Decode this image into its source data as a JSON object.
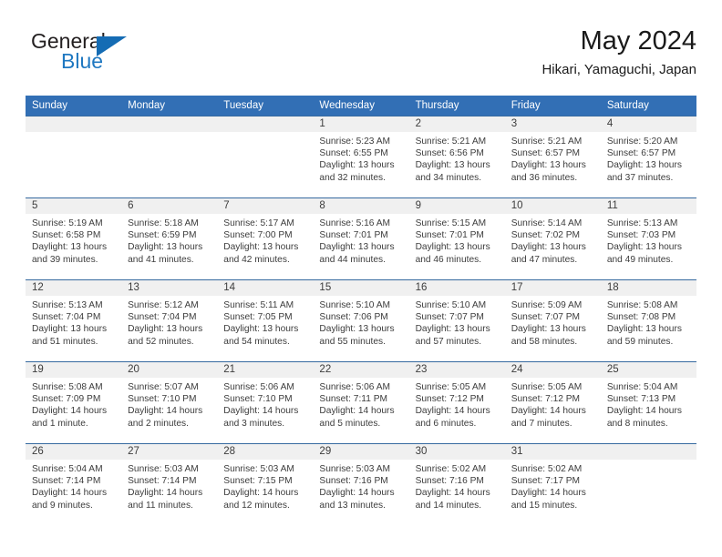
{
  "brand": {
    "word_one": "General",
    "word_two": "Blue",
    "accent_color": "#156cb4",
    "triangle_icon": "brand-triangle-icon"
  },
  "header": {
    "title": "May 2024",
    "subtitle": "Hikari, Yamaguchi, Japan"
  },
  "calendar": {
    "header_bg": "#326fb5",
    "daynum_bg": "#f0f0f0",
    "weekdays": [
      "Sunday",
      "Monday",
      "Tuesday",
      "Wednesday",
      "Thursday",
      "Friday",
      "Saturday"
    ],
    "weeks": [
      [
        {
          "day": "",
          "lines": []
        },
        {
          "day": "",
          "lines": []
        },
        {
          "day": "",
          "lines": []
        },
        {
          "day": "1",
          "lines": [
            "Sunrise: 5:23 AM",
            "Sunset: 6:55 PM",
            "Daylight: 13 hours and 32 minutes."
          ]
        },
        {
          "day": "2",
          "lines": [
            "Sunrise: 5:21 AM",
            "Sunset: 6:56 PM",
            "Daylight: 13 hours and 34 minutes."
          ]
        },
        {
          "day": "3",
          "lines": [
            "Sunrise: 5:21 AM",
            "Sunset: 6:57 PM",
            "Daylight: 13 hours and 36 minutes."
          ]
        },
        {
          "day": "4",
          "lines": [
            "Sunrise: 5:20 AM",
            "Sunset: 6:57 PM",
            "Daylight: 13 hours and 37 minutes."
          ]
        }
      ],
      [
        {
          "day": "5",
          "lines": [
            "Sunrise: 5:19 AM",
            "Sunset: 6:58 PM",
            "Daylight: 13 hours and 39 minutes."
          ]
        },
        {
          "day": "6",
          "lines": [
            "Sunrise: 5:18 AM",
            "Sunset: 6:59 PM",
            "Daylight: 13 hours and 41 minutes."
          ]
        },
        {
          "day": "7",
          "lines": [
            "Sunrise: 5:17 AM",
            "Sunset: 7:00 PM",
            "Daylight: 13 hours and 42 minutes."
          ]
        },
        {
          "day": "8",
          "lines": [
            "Sunrise: 5:16 AM",
            "Sunset: 7:01 PM",
            "Daylight: 13 hours and 44 minutes."
          ]
        },
        {
          "day": "9",
          "lines": [
            "Sunrise: 5:15 AM",
            "Sunset: 7:01 PM",
            "Daylight: 13 hours and 46 minutes."
          ]
        },
        {
          "day": "10",
          "lines": [
            "Sunrise: 5:14 AM",
            "Sunset: 7:02 PM",
            "Daylight: 13 hours and 47 minutes."
          ]
        },
        {
          "day": "11",
          "lines": [
            "Sunrise: 5:13 AM",
            "Sunset: 7:03 PM",
            "Daylight: 13 hours and 49 minutes."
          ]
        }
      ],
      [
        {
          "day": "12",
          "lines": [
            "Sunrise: 5:13 AM",
            "Sunset: 7:04 PM",
            "Daylight: 13 hours and 51 minutes."
          ]
        },
        {
          "day": "13",
          "lines": [
            "Sunrise: 5:12 AM",
            "Sunset: 7:04 PM",
            "Daylight: 13 hours and 52 minutes."
          ]
        },
        {
          "day": "14",
          "lines": [
            "Sunrise: 5:11 AM",
            "Sunset: 7:05 PM",
            "Daylight: 13 hours and 54 minutes."
          ]
        },
        {
          "day": "15",
          "lines": [
            "Sunrise: 5:10 AM",
            "Sunset: 7:06 PM",
            "Daylight: 13 hours and 55 minutes."
          ]
        },
        {
          "day": "16",
          "lines": [
            "Sunrise: 5:10 AM",
            "Sunset: 7:07 PM",
            "Daylight: 13 hours and 57 minutes."
          ]
        },
        {
          "day": "17",
          "lines": [
            "Sunrise: 5:09 AM",
            "Sunset: 7:07 PM",
            "Daylight: 13 hours and 58 minutes."
          ]
        },
        {
          "day": "18",
          "lines": [
            "Sunrise: 5:08 AM",
            "Sunset: 7:08 PM",
            "Daylight: 13 hours and 59 minutes."
          ]
        }
      ],
      [
        {
          "day": "19",
          "lines": [
            "Sunrise: 5:08 AM",
            "Sunset: 7:09 PM",
            "Daylight: 14 hours and 1 minute."
          ]
        },
        {
          "day": "20",
          "lines": [
            "Sunrise: 5:07 AM",
            "Sunset: 7:10 PM",
            "Daylight: 14 hours and 2 minutes."
          ]
        },
        {
          "day": "21",
          "lines": [
            "Sunrise: 5:06 AM",
            "Sunset: 7:10 PM",
            "Daylight: 14 hours and 3 minutes."
          ]
        },
        {
          "day": "22",
          "lines": [
            "Sunrise: 5:06 AM",
            "Sunset: 7:11 PM",
            "Daylight: 14 hours and 5 minutes."
          ]
        },
        {
          "day": "23",
          "lines": [
            "Sunrise: 5:05 AM",
            "Sunset: 7:12 PM",
            "Daylight: 14 hours and 6 minutes."
          ]
        },
        {
          "day": "24",
          "lines": [
            "Sunrise: 5:05 AM",
            "Sunset: 7:12 PM",
            "Daylight: 14 hours and 7 minutes."
          ]
        },
        {
          "day": "25",
          "lines": [
            "Sunrise: 5:04 AM",
            "Sunset: 7:13 PM",
            "Daylight: 14 hours and 8 minutes."
          ]
        }
      ],
      [
        {
          "day": "26",
          "lines": [
            "Sunrise: 5:04 AM",
            "Sunset: 7:14 PM",
            "Daylight: 14 hours and 9 minutes."
          ]
        },
        {
          "day": "27",
          "lines": [
            "Sunrise: 5:03 AM",
            "Sunset: 7:14 PM",
            "Daylight: 14 hours and 11 minutes."
          ]
        },
        {
          "day": "28",
          "lines": [
            "Sunrise: 5:03 AM",
            "Sunset: 7:15 PM",
            "Daylight: 14 hours and 12 minutes."
          ]
        },
        {
          "day": "29",
          "lines": [
            "Sunrise: 5:03 AM",
            "Sunset: 7:16 PM",
            "Daylight: 14 hours and 13 minutes."
          ]
        },
        {
          "day": "30",
          "lines": [
            "Sunrise: 5:02 AM",
            "Sunset: 7:16 PM",
            "Daylight: 14 hours and 14 minutes."
          ]
        },
        {
          "day": "31",
          "lines": [
            "Sunrise: 5:02 AM",
            "Sunset: 7:17 PM",
            "Daylight: 14 hours and 15 minutes."
          ]
        },
        {
          "day": "",
          "lines": []
        }
      ]
    ]
  }
}
